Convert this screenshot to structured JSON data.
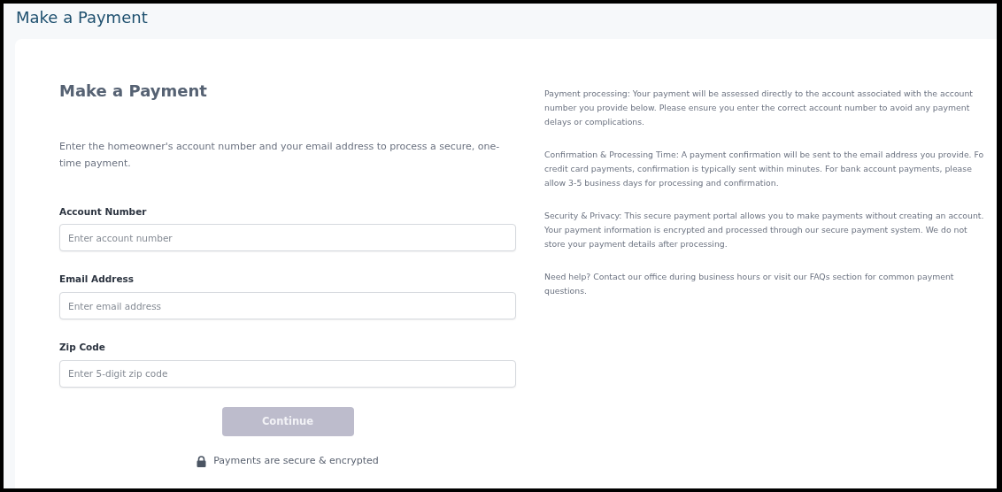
{
  "header": {
    "title": "Make a Payment"
  },
  "form": {
    "heading": "Make a Payment",
    "description": "Enter the homeowner's account number and your email address to process a secure, one-time payment.",
    "fields": [
      {
        "label": "Account Number",
        "placeholder": "Enter account number"
      },
      {
        "label": "Email Address",
        "placeholder": "Enter email address"
      },
      {
        "label": "Zip Code",
        "placeholder": "Enter 5-digit zip code"
      }
    ],
    "submit": {
      "label": "Continue",
      "disabled": true
    },
    "security_note": "Payments are secure & encrypted"
  },
  "info": [
    "Payment processing: Your payment will be assessed directly to the account associated with the account\nnumber you provide below. Please ensure you enter the correct account number to avoid any payment\ndelays or complications.",
    "Confirmation & Processing Time: A payment confirmation will be sent to the email address you provide. Fo\ncredit card payments, confirmation is typically sent within minutes. For bank account payments, please\nallow 3-5 business days for processing and confirmation.",
    "Security & Privacy: This secure payment portal allows you to make payments without creating an account.\nYour payment information is encrypted and processed through our secure payment system. We do not\nstore your payment details after processing.",
    "Need help? Contact our office during business hours or visit our FAQs section for common payment\nquestions."
  ]
}
